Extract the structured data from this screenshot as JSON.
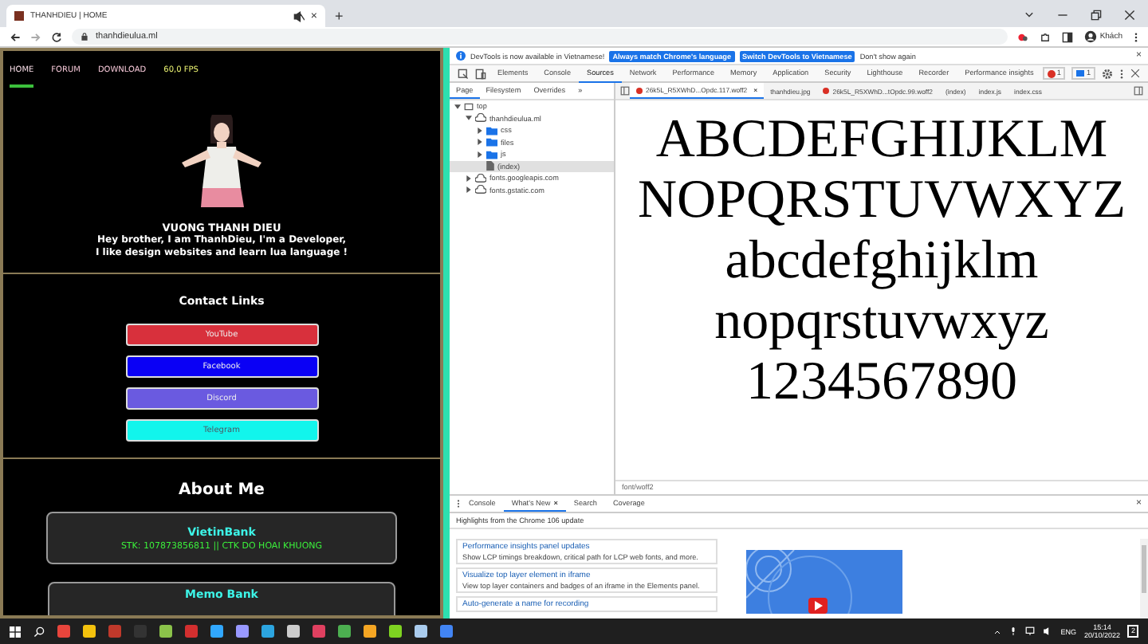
{
  "browser": {
    "tab_title": "THANHDIEU | HOME",
    "tab_close": "×",
    "new_tab": "+",
    "url": "thanhdieulua.ml",
    "profile": "Khách"
  },
  "page": {
    "nav": [
      {
        "label": "HOME",
        "selected": true
      },
      {
        "label": "FORUM",
        "selected": false
      },
      {
        "label": "DOWNLOAD",
        "selected": false
      }
    ],
    "fps": "60,0 FPS",
    "name": "VUONG THANH DIEU",
    "bio": [
      "Hey brother, I am ThanhDieu, I'm a Developer,",
      "I like design websites and learn lua language !"
    ],
    "contact_title": "Contact Links",
    "links": [
      {
        "label": "YouTube",
        "color": "#d8303c"
      },
      {
        "label": "Facebook",
        "color": "#0a00f5"
      },
      {
        "label": "Discord",
        "color": "#6a5ae0"
      },
      {
        "label": "Telegram",
        "color": "#12f5ec"
      }
    ],
    "about_title": "About Me",
    "banks": [
      {
        "name": "VietinBank",
        "account": "STK: 107873856811 || CTK DO HOAI KHUONG"
      },
      {
        "name": "Memo Bank"
      }
    ]
  },
  "devtools": {
    "infobar": {
      "message": "DevTools is now available in Vietnamese!",
      "buttons": [
        "Always match Chrome's language",
        "Switch DevTools to Vietnamese"
      ],
      "dismiss": "Don't show again",
      "close": "×"
    },
    "panels": [
      {
        "label": "Elements",
        "selected": false
      },
      {
        "label": "Console",
        "selected": false
      },
      {
        "label": "Sources",
        "selected": true
      },
      {
        "label": "Network",
        "selected": false
      },
      {
        "label": "Performance",
        "selected": false
      },
      {
        "label": "Memory",
        "selected": false
      },
      {
        "label": "Application",
        "selected": false
      },
      {
        "label": "Security",
        "selected": false
      },
      {
        "label": "Lighthouse",
        "selected": false
      },
      {
        "label": "Recorder",
        "selected": false
      },
      {
        "label": "Performance insights",
        "selected": false
      }
    ],
    "error_count": "1",
    "message_count": "1",
    "navigator_tabs": [
      {
        "label": "Page",
        "selected": true
      },
      {
        "label": "Filesystem",
        "selected": false
      },
      {
        "label": "Overrides",
        "selected": false
      }
    ],
    "navigator_more": "»",
    "tree": [
      {
        "label": "top",
        "kind": "frame",
        "expanded": true,
        "selected": false,
        "children": [
          {
            "label": "thanhdieulua.ml",
            "kind": "cloud",
            "expanded": true,
            "selected": false,
            "children": [
              {
                "label": "css",
                "kind": "folder",
                "expanded": false,
                "selected": false
              },
              {
                "label": "files",
                "kind": "folder",
                "expanded": false,
                "selected": false
              },
              {
                "label": "js",
                "kind": "folder",
                "expanded": false,
                "selected": false
              },
              {
                "label": "(index)",
                "kind": "file",
                "selected": true
              }
            ]
          },
          {
            "label": "fonts.googleapis.com",
            "kind": "cloud",
            "expanded": false,
            "selected": false
          },
          {
            "label": "fonts.gstatic.com",
            "kind": "cloud",
            "expanded": false,
            "selected": false
          }
        ]
      }
    ],
    "editor_tabs": [
      {
        "label": "26k5L_R5XWhD...Opdc.117.woff2",
        "kind": "font",
        "selected": true,
        "close": "×"
      },
      {
        "label": "thanhdieu.jpg",
        "selected": false
      },
      {
        "label": "26k5L_R5XWhD...tOpdc.99.woff2",
        "kind": "font",
        "selected": false
      },
      {
        "label": "(index)",
        "kind": "document",
        "selected": false
      },
      {
        "label": "index.js",
        "kind": "document",
        "selected": false
      },
      {
        "label": "index.css",
        "kind": "document",
        "selected": false
      }
    ],
    "preview_lines": [
      "ABCDEFGHIJKLM",
      "NOPQRSTUVWXYZ",
      "abcdefghijklm",
      "nopqrstuvwxyz",
      "1234567890"
    ],
    "status": "font/woff2",
    "drawer": {
      "tabs": [
        {
          "label": "Console",
          "selected": false
        },
        {
          "label": "What's New",
          "selected": true,
          "close": "×"
        },
        {
          "label": "Search",
          "selected": false
        },
        {
          "label": "Coverage",
          "selected": false
        }
      ],
      "close": "×",
      "heading": "Highlights from the Chrome 106 update",
      "cards": [
        {
          "title": "Performance insights panel updates",
          "description": "Show LCP timings breakdown, critical path for LCP web fonts, and more."
        },
        {
          "title": "Visualize top layer element in iframe",
          "description": "View top layer containers and badges of an iframe in the Elements panel."
        },
        {
          "title": "Auto-generate a name for recording"
        }
      ]
    }
  },
  "taskbar": {
    "language": "ENG",
    "time": "15:14",
    "date": "20/10/2022",
    "notifications": "2"
  }
}
